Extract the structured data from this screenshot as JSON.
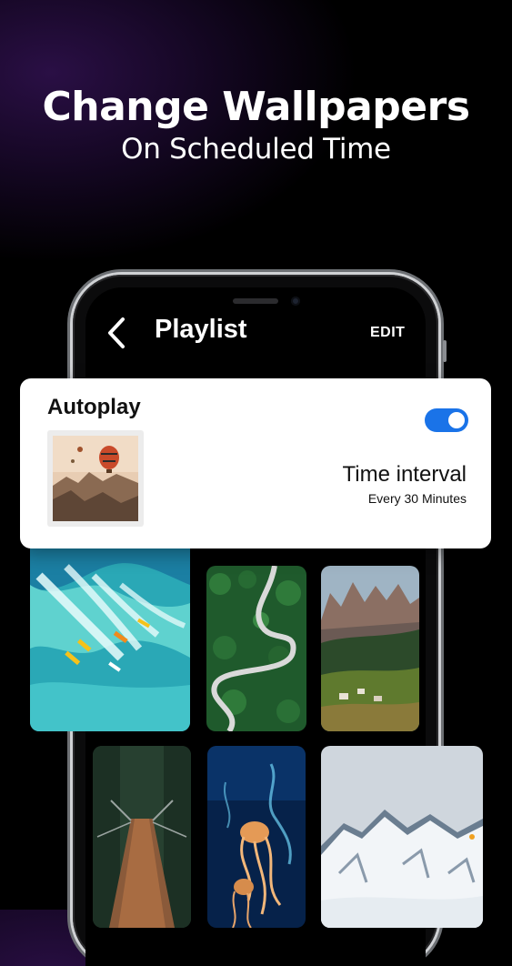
{
  "promo": {
    "headline": "Change Wallpapers",
    "subline": "On Scheduled Time"
  },
  "screen": {
    "title": "Playlist",
    "edit_label": "EDIT",
    "back_icon": "chevron-left-icon"
  },
  "autoplay_card": {
    "title": "Autoplay",
    "toggle_on": true,
    "toggle_color": "#1a73e8",
    "interval_title": "Time interval",
    "interval_value": "Every 30 Minutes"
  },
  "wallpapers": [
    {
      "name": "surfers-wave"
    },
    {
      "name": "forest-road"
    },
    {
      "name": "dolomites-village"
    },
    {
      "name": "forest-suspension-bridge"
    },
    {
      "name": "jellyfish"
    },
    {
      "name": "snowy-mountains"
    }
  ]
}
